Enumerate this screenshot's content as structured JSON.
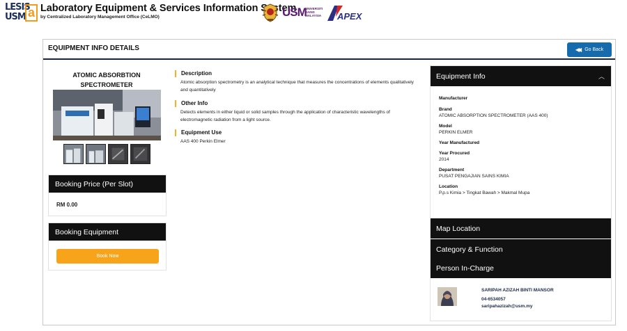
{
  "header": {
    "logo_top": "LESIS",
    "logo_bottom": "USM",
    "logo_mark": "a",
    "title": "Laboratory Equipment & Services Information System",
    "subtitle": "by Centralized Laboratory Management Office (CeLMO)",
    "usm_logo_text": "USM",
    "usm_logo_small": [
      "UNIVERSITI",
      "SAINS",
      "MALAYSIA"
    ],
    "apex_logo_text": "APEX"
  },
  "page": {
    "title": "EQUIPMENT INFO DETAILS",
    "go_back": "Go Back"
  },
  "equipment": {
    "name": "ATOMIC ABSORBTION SPECTROMETER",
    "booking_price_title": "Booking Price (Per Slot)",
    "booking_price": "RM 0.00",
    "booking_title": "Booking Equipment",
    "book_now": "Book Now"
  },
  "details": {
    "description_title": "Description",
    "description": "Atomic absorption spectrometry is an analytical technique that measures the concentrations of elements qualitatively and quantitatively",
    "other_title": "Other Info",
    "other": "Detects elements in either liquid or solid samples through the application of characteristic wavelengths of electromagnetic radiation from a light source.",
    "use_title": "Equipment Use",
    "use": "AAS 400 Perkin Elmer"
  },
  "equipment_info": {
    "title": "Equipment Info",
    "manufacturer_label": "Manufacturer",
    "brand_label": "Brand",
    "brand": "ATOMIC ABSORPTION SPECTROMETER (AAS 400)",
    "model_label": "Model",
    "model": "PERKIN ELMER",
    "year_manufactured_label": "Year Manufactured",
    "year_procured_label": "Year Procured",
    "year_procured": "2014",
    "department_label": "Department",
    "department": "PUSAT PENGAJIAN SAINS KIMIA",
    "location_label": "Location",
    "location": "P.p.s Kimia > Tingkat Bawah > Makmal Mupa"
  },
  "sections": {
    "map": "Map Location",
    "category": "Category & Function",
    "person": "Person In-Charge"
  },
  "person": {
    "name": "SARIPAH AZIZAH BINTI MANSOR",
    "phone": "04-6534057",
    "email": "saripahazizah@usm.my"
  },
  "colors": {
    "accent_blue": "#156bab",
    "accent_orange": "#f8a41b",
    "dark_bar": "#111111",
    "heading_rule": "#f2b02b"
  }
}
